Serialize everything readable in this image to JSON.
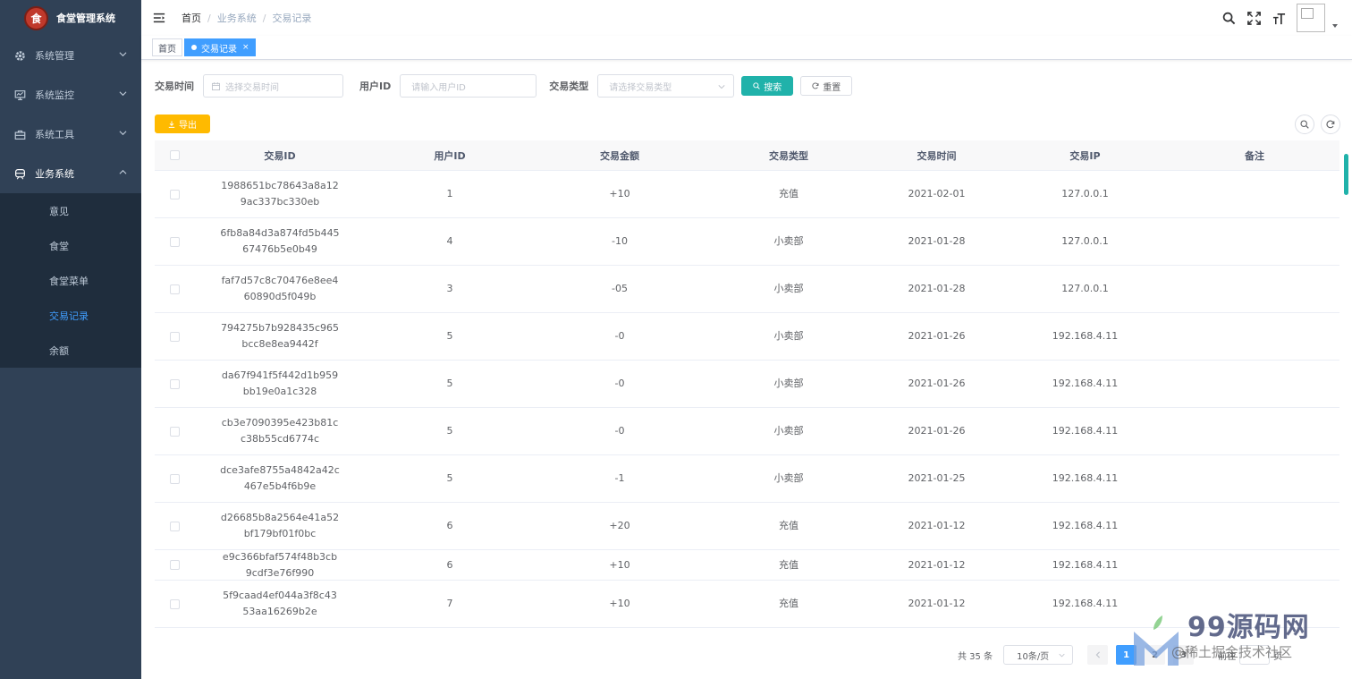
{
  "app": {
    "title": "食堂管理系统",
    "logo_char": "食"
  },
  "sidebar": {
    "menus": [
      {
        "label": "系统管理",
        "icon": "gear-icon"
      },
      {
        "label": "系统监控",
        "icon": "monitor-icon"
      },
      {
        "label": "系统工具",
        "icon": "toolbox-icon"
      },
      {
        "label": "业务系统",
        "icon": "train-icon"
      }
    ],
    "submenu": [
      "意见",
      "食堂",
      "食堂菜单",
      "交易记录",
      "余额"
    ]
  },
  "breadcrumb": {
    "home": "首页",
    "parent": "业务系统",
    "current": "交易记录",
    "sep": "/"
  },
  "tags": {
    "home": "首页",
    "active": "交易记录",
    "close": "×"
  },
  "search": {
    "time_label": "交易时间",
    "time_placeholder": "选择交易时间",
    "uid_label": "用户ID",
    "uid_placeholder": "请输入用户ID",
    "type_label": "交易类型",
    "type_placeholder": "请选择交易类型",
    "search_btn": "搜索",
    "reset_btn": "重置"
  },
  "toolbar": {
    "export_btn": "导出"
  },
  "table": {
    "headers": [
      "交易ID",
      "用户ID",
      "交易金额",
      "交易类型",
      "交易时间",
      "交易IP",
      "备注"
    ],
    "rows": [
      {
        "id": "1988651bc78643a8a129ac337bc330eb",
        "uid": "1",
        "amount": "+10",
        "type": "充值",
        "time": "2021-02-01",
        "ip": "127.0.0.1",
        "note": ""
      },
      {
        "id": "6fb8a84d3a874fd5b44567476b5e0b49",
        "uid": "4",
        "amount": "-10",
        "type": "小卖部",
        "time": "2021-01-28",
        "ip": "127.0.0.1",
        "note": ""
      },
      {
        "id": "faf7d57c8c70476e8ee460890d5f049b",
        "uid": "3",
        "amount": "-05",
        "type": "小卖部",
        "time": "2021-01-28",
        "ip": "127.0.0.1",
        "note": ""
      },
      {
        "id": "794275b7b928435c965bcc8e8ea9442f",
        "uid": "5",
        "amount": "-0",
        "type": "小卖部",
        "time": "2021-01-26",
        "ip": "192.168.4.11",
        "note": ""
      },
      {
        "id": "da67f941f5f442d1b959bb19e0a1c328",
        "uid": "5",
        "amount": "-0",
        "type": "小卖部",
        "time": "2021-01-26",
        "ip": "192.168.4.11",
        "note": ""
      },
      {
        "id": "cb3e7090395e423b81cc38b55cd6774c",
        "uid": "5",
        "amount": "-0",
        "type": "小卖部",
        "time": "2021-01-26",
        "ip": "192.168.4.11",
        "note": ""
      },
      {
        "id": "dce3afe8755a4842a42c467e5b4f6b9e",
        "uid": "5",
        "amount": "-1",
        "type": "小卖部",
        "time": "2021-01-25",
        "ip": "192.168.4.11",
        "note": ""
      },
      {
        "id": "d26685b8a2564e41a52bf179bf01f0bc",
        "uid": "6",
        "amount": "+20",
        "type": "充值",
        "time": "2021-01-12",
        "ip": "192.168.4.11",
        "note": ""
      },
      {
        "id": "e9c366bfaf574f48b3cb9cdf3e76f990",
        "uid": "6",
        "amount": "+10",
        "type": "充值",
        "time": "2021-01-12",
        "ip": "192.168.4.11",
        "note": ""
      },
      {
        "id": "5f9caad4ef044a3f8c4353aa16269b2e",
        "uid": "7",
        "amount": "+10",
        "type": "充值",
        "time": "2021-01-12",
        "ip": "192.168.4.11",
        "note": ""
      }
    ]
  },
  "pagination": {
    "total": "共 35 条",
    "page_size": "10条/页",
    "pages": [
      "1",
      "2",
      "3"
    ],
    "goto_prefix": "前往",
    "goto_suffix": "页"
  },
  "watermark": {
    "brand": "99源码网",
    "sub": "@稀土掘金技术社区"
  },
  "colors": {
    "sidebar_bg": "#304156",
    "submenu_bg": "#1f2d3d",
    "primary": "#409eff",
    "search_btn": "#20b2aa",
    "export_btn": "#ffba00"
  }
}
